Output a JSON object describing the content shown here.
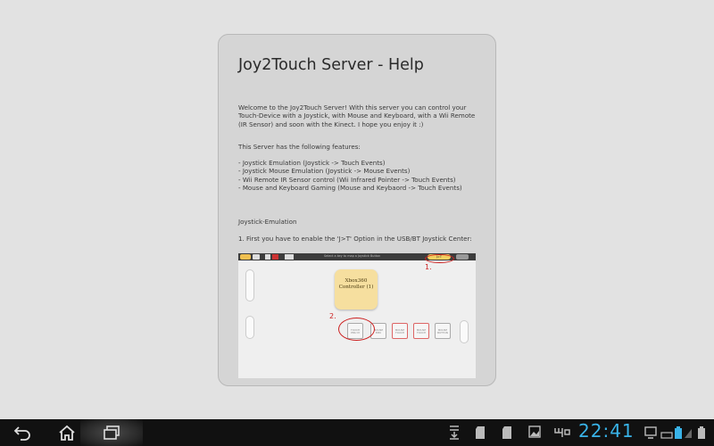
{
  "help": {
    "title": "Joy2Touch Server - Help",
    "welcome": "Welcome to the Joy2Touch Server! With this server you can control your Touch-Device with a Joystick, with Mouse and Keyboard, with a Wii Remote (IR Sensor) and soon with the Kinect. I hope you enjoy it :)",
    "features_heading": "This Server has the following features:",
    "features": [
      "- Joystick Emulation (Joystick -> Touch Events)",
      "- Joystick Mouse Emulation (Joystick -> Mouse Events)",
      "- Wii Remote IR Sensor control (Wii Infrared Pointer -> Touch Events)",
      "- Mouse and Keyboard Gaming (Mouse and Keybaord -> Touch Events)"
    ],
    "section_title": "Joystick-Emulation",
    "step1": "1. First you have to enable the 'J>T' Option in the USB/BT Joystick Center:"
  },
  "screenshot": {
    "toolbar_text": "Select a key to map a Joystick Button",
    "jt_label": "J>T",
    "controller_label": "Xbox360 Controller (1)",
    "annotation_1": "1.",
    "annotation_2": "2.",
    "slots": [
      "TOUCH EMU M",
      "MOUSE EMU",
      "MOUSE TOUCH",
      "MOUSE TOUCH",
      "MOUSE BUTTON"
    ]
  },
  "statusbar": {
    "clock": "22:41"
  },
  "colors": {
    "background": "#e2e2e2",
    "panel": "#d5d5d5",
    "clock": "#39b3e8",
    "annotation": "#cc2020"
  }
}
